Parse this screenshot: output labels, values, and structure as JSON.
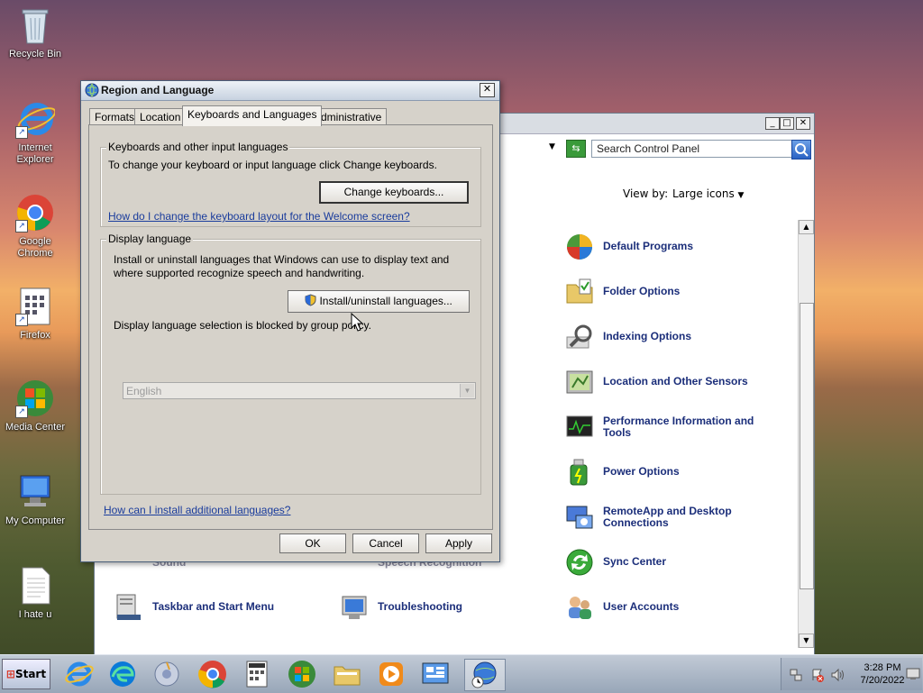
{
  "desktop": {
    "icons": [
      {
        "label": "Recycle Bin"
      },
      {
        "label": "Internet Explorer"
      },
      {
        "label": "Google Chrome"
      },
      {
        "label": "Firefox"
      },
      {
        "label": "Media Center"
      },
      {
        "label": "My Computer"
      },
      {
        "label": "I hate u"
      }
    ]
  },
  "control_panel": {
    "search_placeholder": "Search Control Panel",
    "view_by_label": "View by:",
    "view_by_value": "Large icons",
    "items": [
      {
        "label": "Default Programs"
      },
      {
        "label": "Folder Options"
      },
      {
        "label": "Indexing Options"
      },
      {
        "label": "Location and Other Sensors"
      },
      {
        "label": "Performance Information and Tools"
      },
      {
        "label": "Power Options"
      },
      {
        "label": "RemoteApp and Desktop Connections"
      },
      {
        "label": "Sync Center"
      },
      {
        "label": "User Accounts"
      },
      {
        "label": "Taskbar and Start Menu"
      },
      {
        "label": "Troubleshooting"
      },
      {
        "label": "Sound"
      },
      {
        "label": "Speech Recognition"
      }
    ]
  },
  "dialog": {
    "title": "Region and Language",
    "tabs": [
      {
        "label": "Formats"
      },
      {
        "label": "Location"
      },
      {
        "label": "Keyboards and Languages"
      },
      {
        "label": "Administrative"
      }
    ],
    "keyboards_group": {
      "label": "Keyboards and other input languages",
      "description": "To change your keyboard or input language click Change keyboards.",
      "button": "Change keyboards...",
      "link": "How do I change the keyboard layout for the Welcome screen?"
    },
    "display_group": {
      "label": "Display language",
      "description": "Install or uninstall languages that Windows can use to display text and where supported recognize speech and handwriting.",
      "button": "Install/uninstall languages...",
      "blocked_text": "Display language selection is blocked by group policy.",
      "selected_language": "English"
    },
    "install_link": "How can I install additional languages?",
    "ok": "OK",
    "cancel": "Cancel",
    "apply": "Apply"
  },
  "taskbar": {
    "start_label": "Start",
    "time": "3:28 PM",
    "date": "7/20/2022"
  }
}
